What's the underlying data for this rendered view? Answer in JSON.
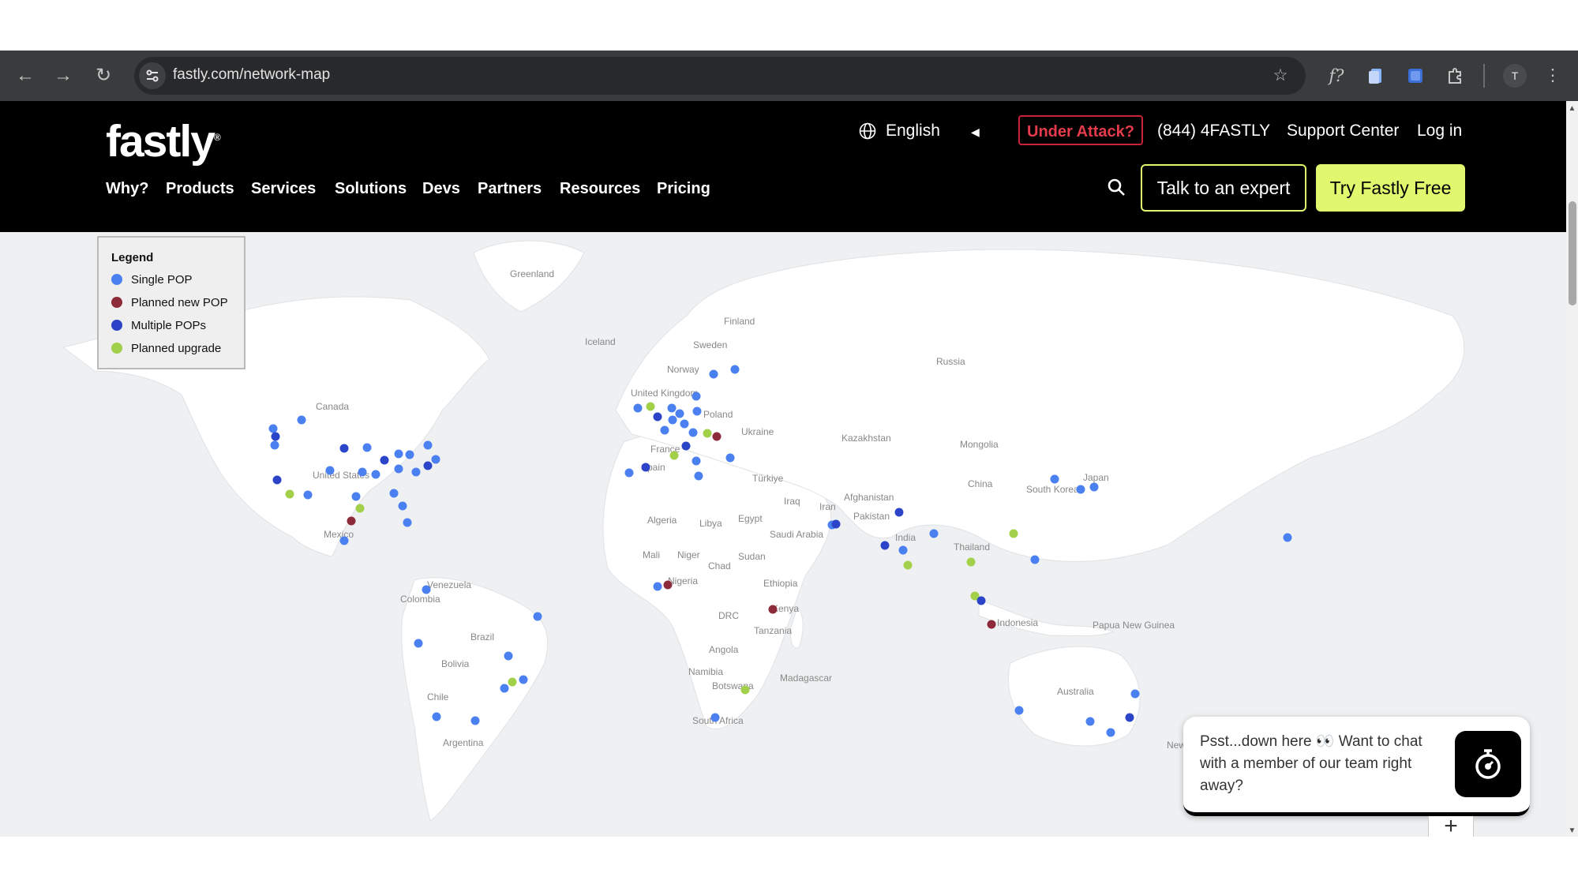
{
  "browser": {
    "url": "fastly.com/network-map",
    "profile_initial": "T",
    "icons": [
      "back-arrow-icon",
      "forward-arrow-icon",
      "reload-icon",
      "site-settings-icon",
      "bookmark-star-icon",
      "fx-extension-icon",
      "docs-extension-icon",
      "blue-extension-icon",
      "puzzle-extensions-icon",
      "kebab-menu-icon"
    ]
  },
  "header": {
    "logo": "fastly",
    "language": "English",
    "under_attack": "Under Attack?",
    "phone": "(844) 4FASTLY",
    "support": "Support Center",
    "login": "Log in",
    "nav": [
      "Why?",
      "Products",
      "Services",
      "Solutions",
      "Devs",
      "Partners",
      "Resources",
      "Pricing"
    ],
    "talk_expert": "Talk to an expert",
    "try_free": "Try Fastly Free",
    "accent_color": "#e1f86e",
    "attack_color": "#e53b4c"
  },
  "legend": {
    "title": "Legend",
    "items": [
      {
        "label": "Single POP",
        "color": "#4a80f0"
      },
      {
        "label": "Planned new POP",
        "color": "#8e2b3a"
      },
      {
        "label": "Multiple POPs",
        "color": "#2c45c8"
      },
      {
        "label": "Planned upgrade",
        "color": "#a3d04a"
      }
    ]
  },
  "map_labels": [
    "Greenland",
    "Finland",
    "Iceland",
    "Sweden",
    "Norway",
    "Russia",
    "United Kingdom",
    "Poland",
    "Canada",
    "Ukraine",
    "France",
    "Kazakhstan",
    "Mongolia",
    "Spain",
    "Türkiye",
    "Afghanistan",
    "China",
    "United States",
    "South Korea",
    "Japan",
    "Iraq",
    "Iran",
    "Pakistan",
    "Algeria",
    "Libya",
    "Egypt",
    "Mexico",
    "Saudi Arabia",
    "India",
    "Thailand",
    "Mali",
    "Niger",
    "Sudan",
    "Chad",
    "Nigeria",
    "Ethiopia",
    "Venezuela",
    "Colombia",
    "Kenya",
    "DRC",
    "Indonesia",
    "Papua New Guinea",
    "Tanzania",
    "Brazil",
    "Angola",
    "Bolivia",
    "Namibia",
    "Madagascar",
    "Botswana",
    "Australia",
    "South Africa",
    "Chile",
    "Argentina",
    "New Zealand"
  ],
  "chat": {
    "message": "Psst...down here 👀 Want to chat with a member of our team right away?",
    "plus": "+"
  }
}
